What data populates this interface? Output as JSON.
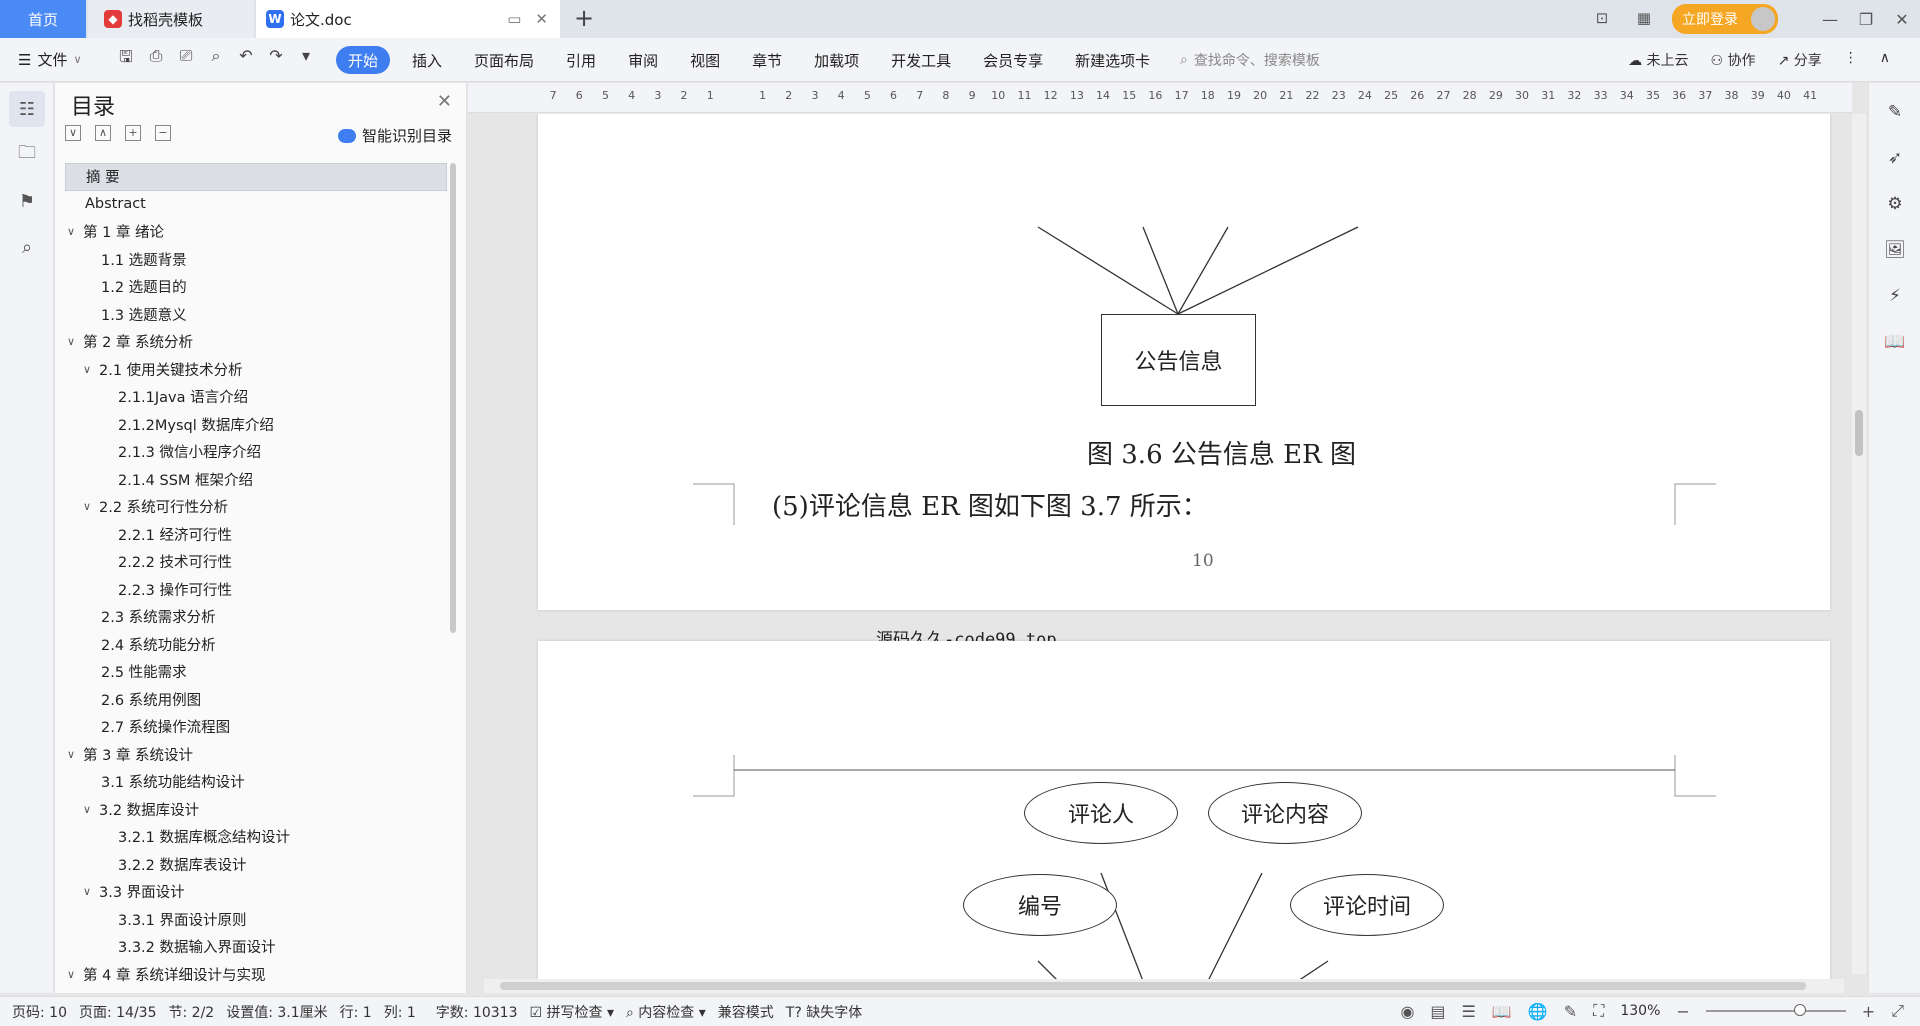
{
  "tabs": {
    "home": "首页",
    "daoke": "找稻壳模板",
    "doc": "论文.doc",
    "new_tab": "+"
  },
  "window": {
    "login": "立即登录"
  },
  "menu": {
    "file": "文件",
    "tabs": [
      "开始",
      "插入",
      "页面布局",
      "引用",
      "审阅",
      "视图",
      "章节",
      "加载项",
      "开发工具",
      "会员专享",
      "新建选项卡"
    ],
    "search_placeholder": "查找命令、搜索模板",
    "cloud": "未上云",
    "collab": "协作",
    "share": "分享"
  },
  "toc": {
    "title": "目录",
    "smart": "智能识别目录",
    "items": [
      {
        "label": "摘  要",
        "level": 1,
        "chev": false,
        "selected": true
      },
      {
        "label": "Abstract",
        "level": 1,
        "chev": false
      },
      {
        "label": "第 1 章   绪论",
        "level": 1,
        "chev": true
      },
      {
        "label": "1.1 选题背景",
        "level": 2,
        "chev": false
      },
      {
        "label": "1.2 选题目的",
        "level": 2,
        "chev": false
      },
      {
        "label": "1.3 选题意义",
        "level": 2,
        "chev": false
      },
      {
        "label": "第 2 章  系统分析",
        "level": 1,
        "chev": true
      },
      {
        "label": "2.1 使用关键技术分析",
        "level": 2,
        "chev": true
      },
      {
        "label": "2.1.1Java 语言介绍",
        "level": 3,
        "chev": false
      },
      {
        "label": "2.1.2Mysql 数据库介绍",
        "level": 3,
        "chev": false
      },
      {
        "label": "2.1.3 微信小程序介绍",
        "level": 3,
        "chev": false
      },
      {
        "label": "2.1.4 SSM 框架介绍",
        "level": 3,
        "chev": false
      },
      {
        "label": "2.2 系统可行性分析",
        "level": 2,
        "chev": true
      },
      {
        "label": "2.2.1 经济可行性",
        "level": 3,
        "chev": false
      },
      {
        "label": "2.2.2 技术可行性",
        "level": 3,
        "chev": false
      },
      {
        "label": "2.2.3 操作可行性",
        "level": 3,
        "chev": false
      },
      {
        "label": "2.3 系统需求分析",
        "level": 2,
        "chev": false
      },
      {
        "label": "2.4 系统功能分析",
        "level": 2,
        "chev": false
      },
      {
        "label": "2.5 性能需求",
        "level": 2,
        "chev": false
      },
      {
        "label": "2.6 系统用例图",
        "level": 2,
        "chev": false
      },
      {
        "label": "2.7 系统操作流程图",
        "level": 2,
        "chev": false
      },
      {
        "label": "第 3 章  系统设计",
        "level": 1,
        "chev": true
      },
      {
        "label": "3.1 系统功能结构设计",
        "level": 2,
        "chev": false
      },
      {
        "label": "3.2 数据库设计",
        "level": 2,
        "chev": true
      },
      {
        "label": "3.2.1 数据库概念结构设计",
        "level": 3,
        "chev": false
      },
      {
        "label": "3.2.2 数据库表设计",
        "level": 3,
        "chev": false
      },
      {
        "label": "3.3 界面设计",
        "level": 2,
        "chev": true
      },
      {
        "label": "3.3.1 界面设计原则",
        "level": 3,
        "chev": false
      },
      {
        "label": "3.3.2 数据输入界面设计",
        "level": 3,
        "chev": false
      },
      {
        "label": "第 4 章  系统详细设计与实现",
        "level": 1,
        "chev": true
      }
    ]
  },
  "ruler": [
    "7",
    "6",
    "5",
    "4",
    "3",
    "2",
    "1",
    "",
    "1",
    "2",
    "3",
    "4",
    "5",
    "6",
    "7",
    "8",
    "9",
    "10",
    "11",
    "12",
    "13",
    "14",
    "15",
    "16",
    "17",
    "18",
    "19",
    "20",
    "21",
    "22",
    "23",
    "24",
    "25",
    "26",
    "27",
    "28",
    "29",
    "30",
    "31",
    "32",
    "33",
    "34",
    "35",
    "36",
    "37",
    "38",
    "39",
    "40",
    "41"
  ],
  "document": {
    "entity1": "公告信息",
    "caption1": "图 3.6 公告信息 ER 图",
    "para1": "(5)评论信息 ER 图如下图 3.7 所示：",
    "page_number": "10",
    "footer": "源码久久-code99.top",
    "attrs2": {
      "a1": "评论人",
      "a2": "评论内容",
      "a3": "编号",
      "a4": "评论时间"
    }
  },
  "status": {
    "page_code": "页码: 10",
    "page": "页面: 14/35",
    "section": "节: 2/2",
    "setting": "设置值: 3.1厘米",
    "row": "行: 1",
    "col": "列: 1",
    "words": "字数: 10313",
    "spell": "拼写检查",
    "content": "内容检查",
    "compat": "兼容模式",
    "font_missing": "缺失字体",
    "zoom": "130%"
  }
}
